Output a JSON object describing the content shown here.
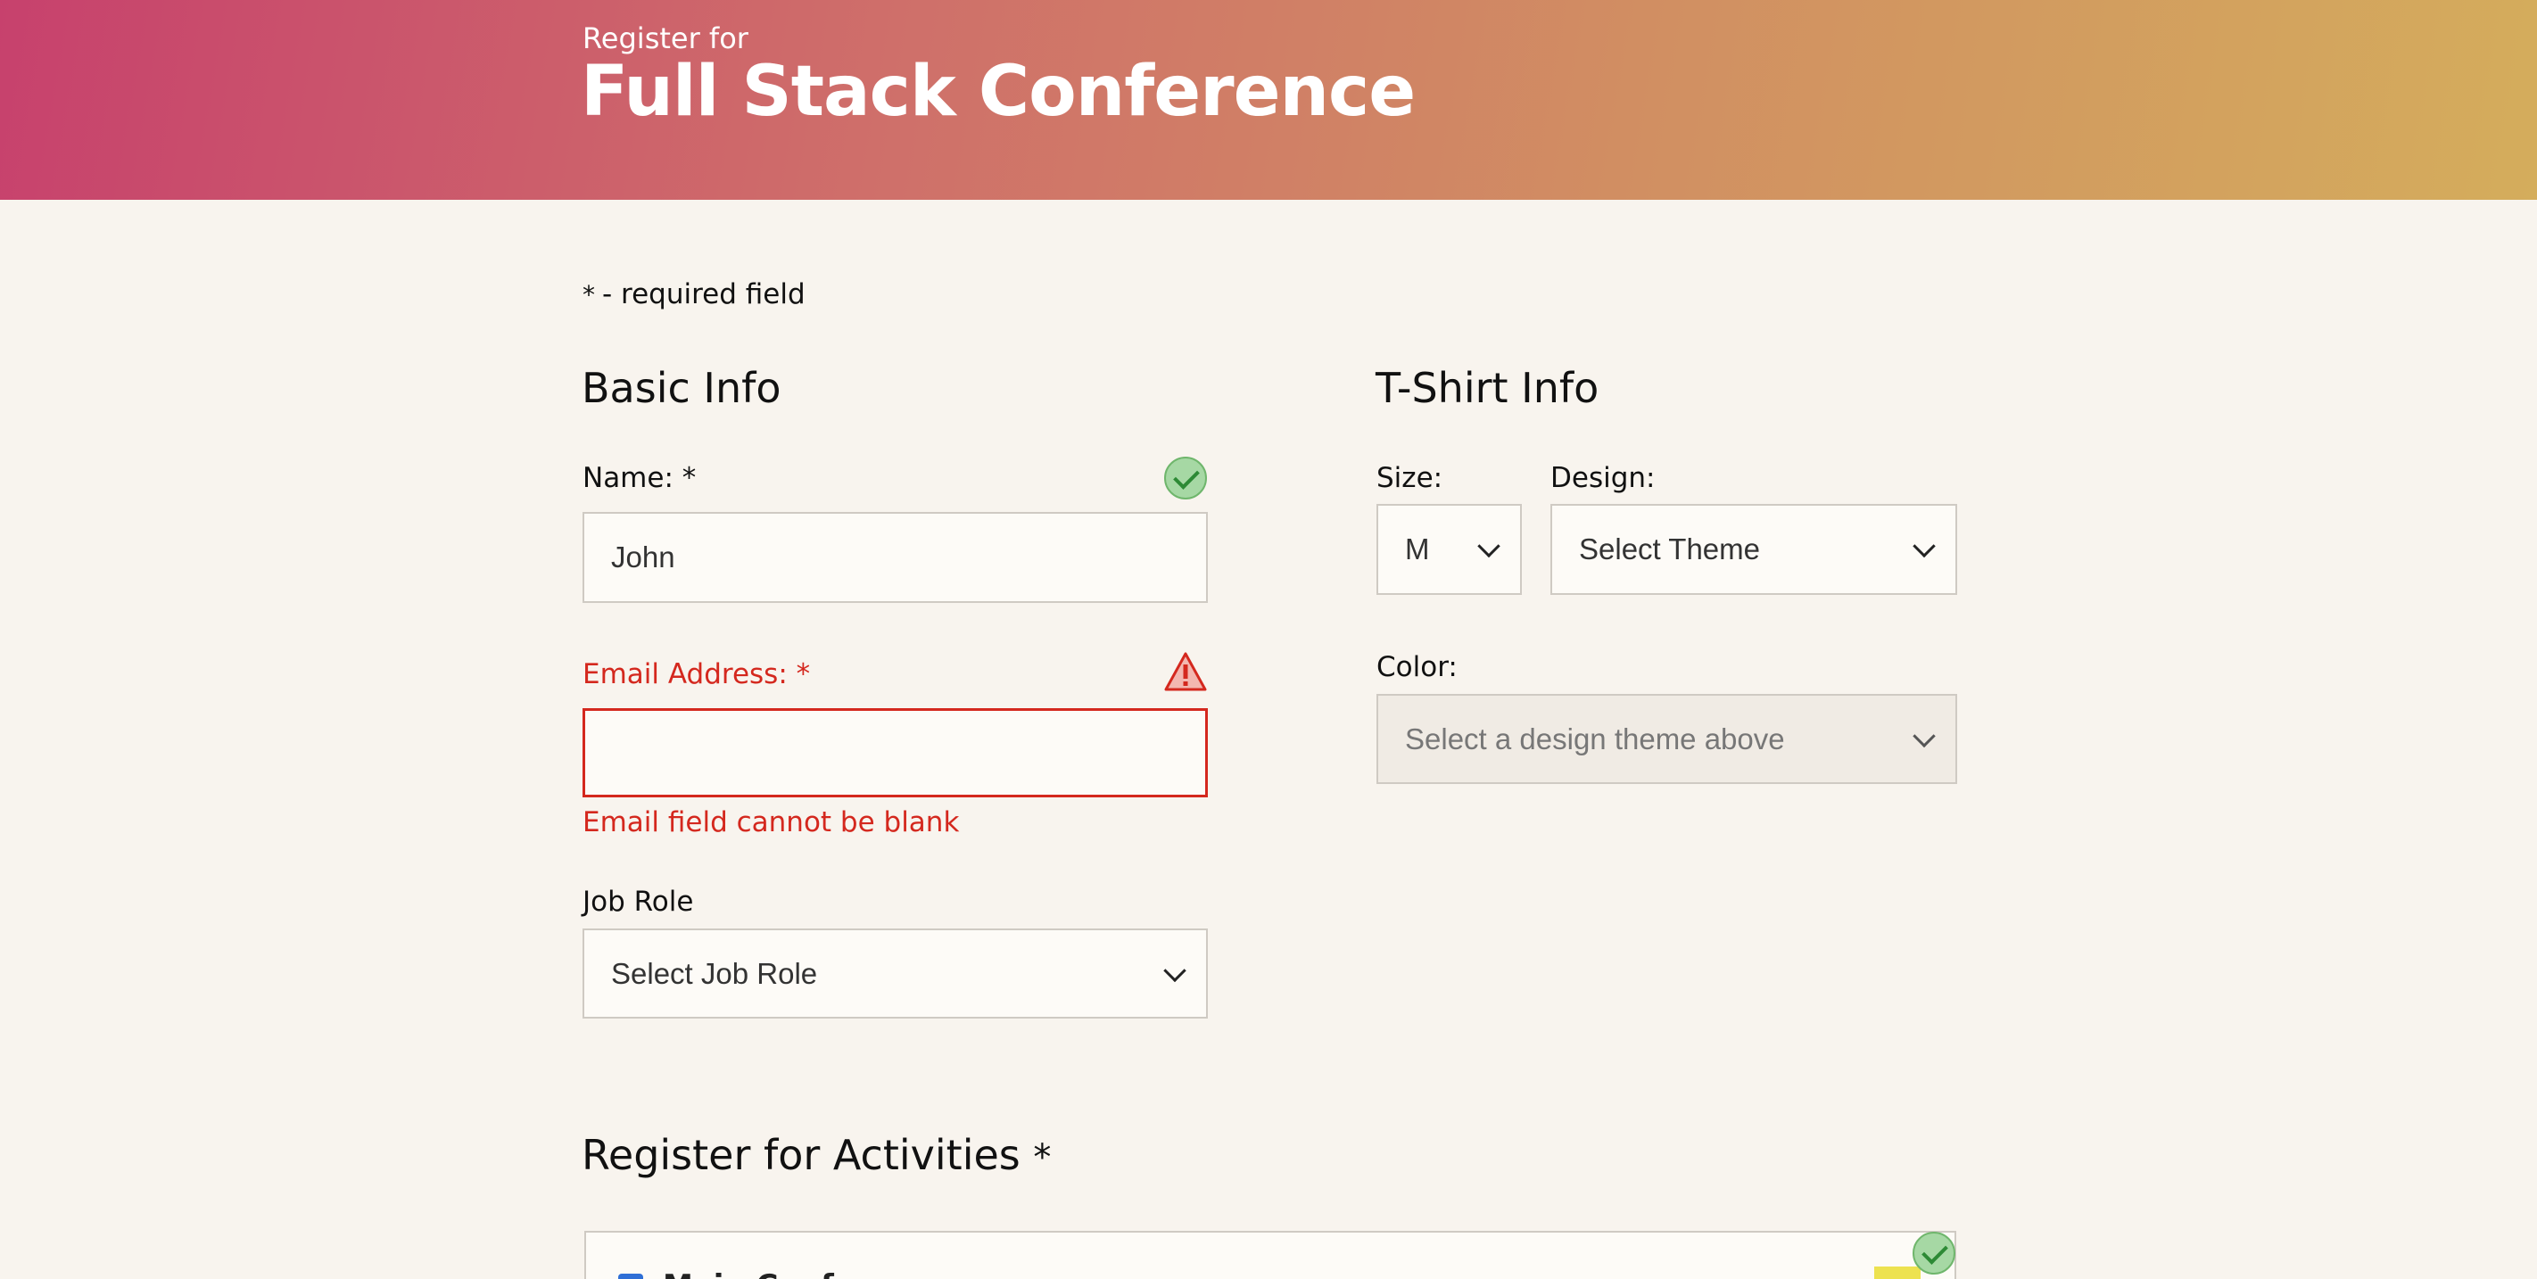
{
  "header": {
    "subtitle": "Register for",
    "title": "Full Stack Conference"
  },
  "required_note": {
    "asterisk": "*",
    "text": "- required field"
  },
  "basic_info": {
    "heading": "Basic Info",
    "name": {
      "label": "Name: *",
      "value": "John",
      "status_icon": "check-circle-icon"
    },
    "email": {
      "label": "Email Address: *",
      "value": "",
      "status_icon": "warning-triangle-icon",
      "error": "Email field cannot be blank"
    },
    "job_role": {
      "label": "Job Role",
      "selected": "Select Job Role"
    }
  },
  "tshirt_info": {
    "heading": "T-Shirt Info",
    "size": {
      "label": "Size:",
      "selected": "M"
    },
    "design": {
      "label": "Design:",
      "selected": "Select Theme"
    },
    "color": {
      "label": "Color:",
      "selected": "Select a design theme above"
    }
  },
  "activities": {
    "heading": "Register for Activities",
    "asterisk": "*",
    "status_icon": "check-circle-icon",
    "first_item": {
      "label": "Main Conf",
      "checked": true
    }
  },
  "colors": {
    "error": "#d4281e",
    "success": "#6fb66c",
    "header_start": "#c7416d",
    "header_end": "#d4ad5c",
    "background": "#f8f4ee"
  }
}
